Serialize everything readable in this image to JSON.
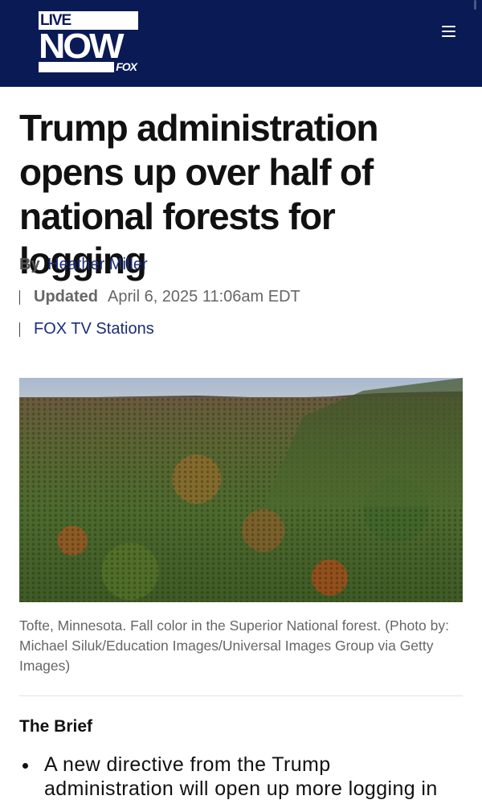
{
  "header": {
    "logo": {
      "line1": "LIVE",
      "line2": "NOW",
      "line3": "FOX"
    },
    "menu_icon": "hamburger-menu-icon",
    "background_color": "#0a1a55"
  },
  "article": {
    "headline": "Trump administration opens up over half of national forests for logging",
    "byline_prefix": "By",
    "author": "Heather Miller",
    "updated_label": "Updated",
    "updated_date": "April 6, 2025 11:06am EDT",
    "source": "FOX TV Stations",
    "image_caption": "Tofte, Minnesota. Fall color in the Superior National forest. (Photo by: Michael Siluk/Education Images/Universal Images Group via Getty Images)"
  },
  "brief": {
    "title": "The Brief",
    "items": [
      "A new directive from the Trump administration will open up more logging in"
    ]
  },
  "colors": {
    "navy": "#0a1a55",
    "link": "#1a2e78",
    "meta_gray": "#666666"
  }
}
